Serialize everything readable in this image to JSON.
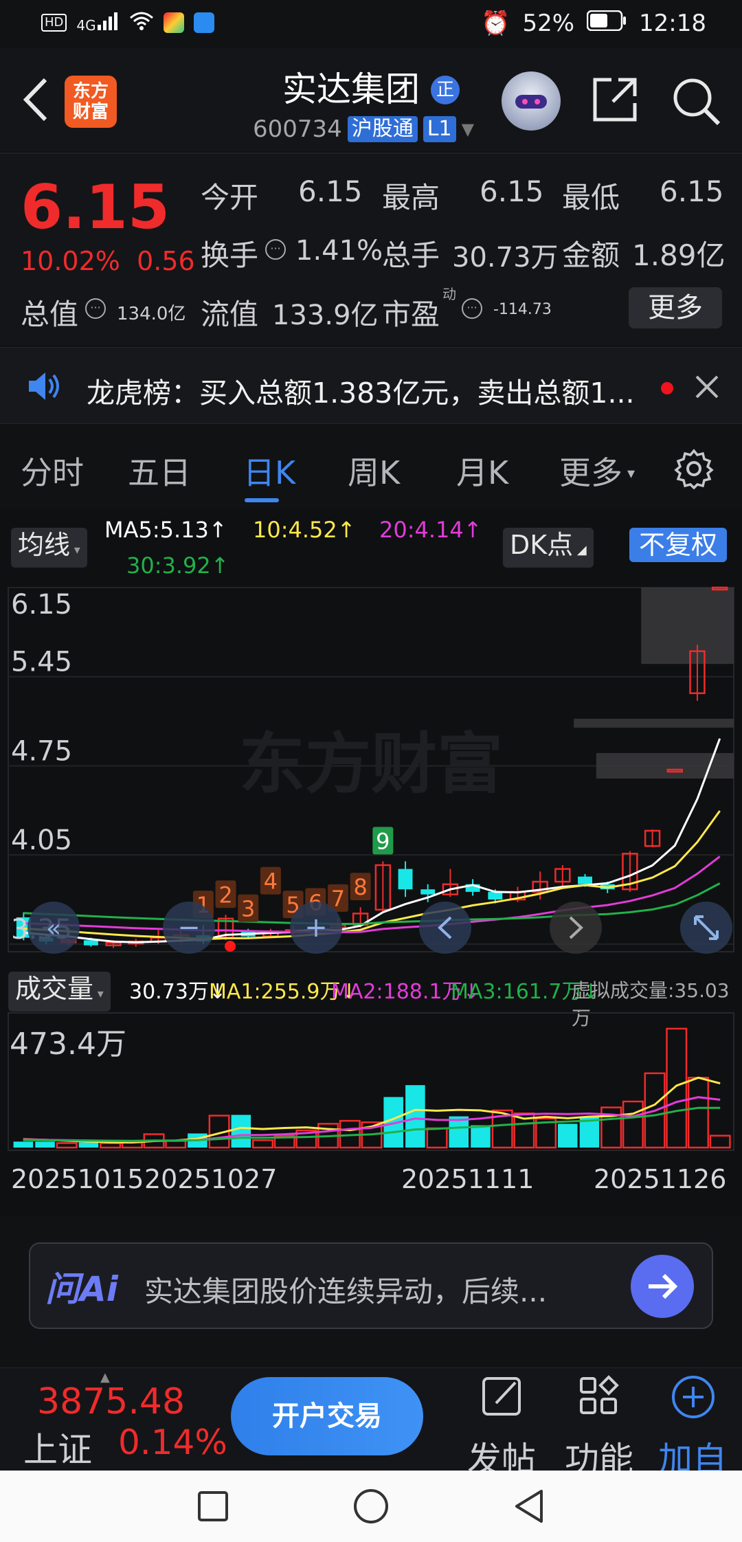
{
  "status_bar": {
    "net_left": "HD",
    "signal": "4G",
    "battery": "52%",
    "time": "12:18"
  },
  "header": {
    "logo_text": "东方财富",
    "title": "实达集团",
    "badge": "正",
    "code": "600734",
    "exchange_tag": "沪股通",
    "level_tag": "L1"
  },
  "quote": {
    "price": "6.15",
    "change_pct": "10.02%",
    "change_abs": "0.56",
    "open_label": "今开",
    "open": "6.15",
    "high_label": "最高",
    "high": "6.15",
    "low_label": "最低",
    "low": "6.15",
    "turnover_label": "换手",
    "turnover": "1.41%",
    "volume_label": "总手",
    "volume": "30.73万",
    "amount_label": "金额",
    "amount": "1.89亿",
    "mktcap_label": "总值",
    "mktcap": "134.0亿",
    "float_label": "流值",
    "float": "133.9亿",
    "pe_label": "市盈",
    "pe_sup": "动",
    "pe": "-114.73",
    "more_label": "更多"
  },
  "news": {
    "text": "龙虎榜：买入总额1.383亿元，卖出总额1..."
  },
  "tabs": [
    {
      "label": "分时"
    },
    {
      "label": "五日"
    },
    {
      "label": "日K"
    },
    {
      "label": "周K"
    },
    {
      "label": "月K"
    },
    {
      "label": "更多"
    }
  ],
  "kline_header": {
    "ma_select": "均线",
    "ma5": "MA5:5.13↑",
    "ma10": "10:4.52↑",
    "ma20": "20:4.14↑",
    "ma30": "30:3.92↑",
    "dk_label": "DK点",
    "adjust_label": "不复权",
    "watermark": "东方财富"
  },
  "volume_header": {
    "select": "成交量",
    "vol": "30.73万↓",
    "ma1": "MA1:255.9万↓",
    "ma2": "MA2:188.1万↓",
    "ma3": "MA3:161.7万↓",
    "virtual": "虚拟成交量:35.03万",
    "max_label": "473.4万"
  },
  "dates": [
    "20251015",
    "20251027",
    "20251111",
    "20251126"
  ],
  "colors": {
    "up": "#f02b2b",
    "down": "#19e6e6",
    "ma5": "#ffffff",
    "ma10": "#ffe94a",
    "ma20": "#e23cd8",
    "ma30": "#21b14a",
    "accent": "#3f86f0"
  },
  "chart_data": {
    "type": "candlestick",
    "y_ticks": [
      "6.15",
      "5.45",
      "4.75",
      "4.05",
      "3.35"
    ],
    "ylim": [
      3.35,
      6.15
    ],
    "td_counts": [
      "1",
      "2",
      "3",
      "4",
      "5",
      "6",
      "7",
      "8",
      "9"
    ],
    "candles": [
      {
        "o": 3.56,
        "c": 3.4,
        "h": 3.6,
        "l": 3.38
      },
      {
        "o": 3.4,
        "c": 3.37,
        "h": 3.43,
        "l": 3.35
      },
      {
        "o": 3.37,
        "c": 3.38,
        "h": 3.4,
        "l": 3.34
      },
      {
        "o": 3.38,
        "c": 3.34,
        "h": 3.4,
        "l": 3.33
      },
      {
        "o": 3.34,
        "c": 3.36,
        "h": 3.38,
        "l": 3.32
      },
      {
        "o": 3.36,
        "c": 3.37,
        "h": 3.39,
        "l": 3.33
      },
      {
        "o": 3.37,
        "c": 3.4,
        "h": 3.46,
        "l": 3.35
      },
      {
        "o": 3.4,
        "c": 3.42,
        "h": 3.48,
        "l": 3.36
      },
      {
        "o": 3.42,
        "c": 3.37,
        "h": 3.5,
        "l": 3.35
      },
      {
        "o": 3.4,
        "c": 3.55,
        "h": 3.58,
        "l": 3.38
      },
      {
        "o": 3.45,
        "c": 3.41,
        "h": 3.47,
        "l": 3.39
      },
      {
        "o": 3.41,
        "c": 3.44,
        "h": 3.47,
        "l": 3.4
      },
      {
        "o": 3.44,
        "c": 3.46,
        "h": 3.5,
        "l": 3.42
      },
      {
        "o": 3.46,
        "c": 3.48,
        "h": 3.52,
        "l": 3.43
      },
      {
        "o": 3.48,
        "c": 3.5,
        "h": 3.55,
        "l": 3.45
      },
      {
        "o": 3.5,
        "c": 3.59,
        "h": 3.64,
        "l": 3.48
      },
      {
        "o": 3.62,
        "c": 3.97,
        "h": 4.0,
        "l": 3.6
      },
      {
        "o": 3.94,
        "c": 3.78,
        "h": 4.0,
        "l": 3.72
      },
      {
        "o": 3.78,
        "c": 3.74,
        "h": 3.82,
        "l": 3.68
      },
      {
        "o": 3.74,
        "c": 3.82,
        "h": 3.94,
        "l": 3.72
      },
      {
        "o": 3.82,
        "c": 3.76,
        "h": 3.86,
        "l": 3.73
      },
      {
        "o": 3.76,
        "c": 3.7,
        "h": 3.78,
        "l": 3.67
      },
      {
        "o": 3.7,
        "c": 3.76,
        "h": 3.8,
        "l": 3.68
      },
      {
        "o": 3.76,
        "c": 3.84,
        "h": 3.92,
        "l": 3.7
      },
      {
        "o": 3.84,
        "c": 3.94,
        "h": 3.97,
        "l": 3.8
      },
      {
        "o": 3.88,
        "c": 3.82,
        "h": 3.9,
        "l": 3.8
      },
      {
        "o": 3.82,
        "c": 3.78,
        "h": 3.84,
        "l": 3.75
      },
      {
        "o": 3.78,
        "c": 4.06,
        "h": 4.08,
        "l": 3.76
      },
      {
        "o": 4.12,
        "c": 4.24,
        "h": 4.25,
        "l": 4.11
      },
      {
        "o": 4.72,
        "c": 4.72,
        "h": 4.72,
        "l": 4.72
      },
      {
        "o": 5.32,
        "c": 5.65,
        "h": 5.7,
        "l": 5.26
      },
      {
        "o": 6.15,
        "c": 6.15,
        "h": 6.15,
        "l": 6.15
      }
    ],
    "volume": [
      40,
      40,
      30,
      35,
      30,
      35,
      90,
      45,
      95,
      215,
      220,
      50,
      80,
      115,
      160,
      180,
      170,
      340,
      420,
      130,
      210,
      150,
      250,
      230,
      195,
      160,
      205,
      270,
      310,
      500,
      800,
      470,
      80
    ]
  },
  "ai_bar": {
    "brand": "问Ai",
    "prompt": "实达集团股价连续异动，后续..."
  },
  "bottom": {
    "index_value": "3875.48",
    "index_name": "上证",
    "index_pct": "0.14%",
    "trade_label": "开户交易",
    "post_label": "发帖",
    "func_label": "功能",
    "add_label": "加自"
  }
}
